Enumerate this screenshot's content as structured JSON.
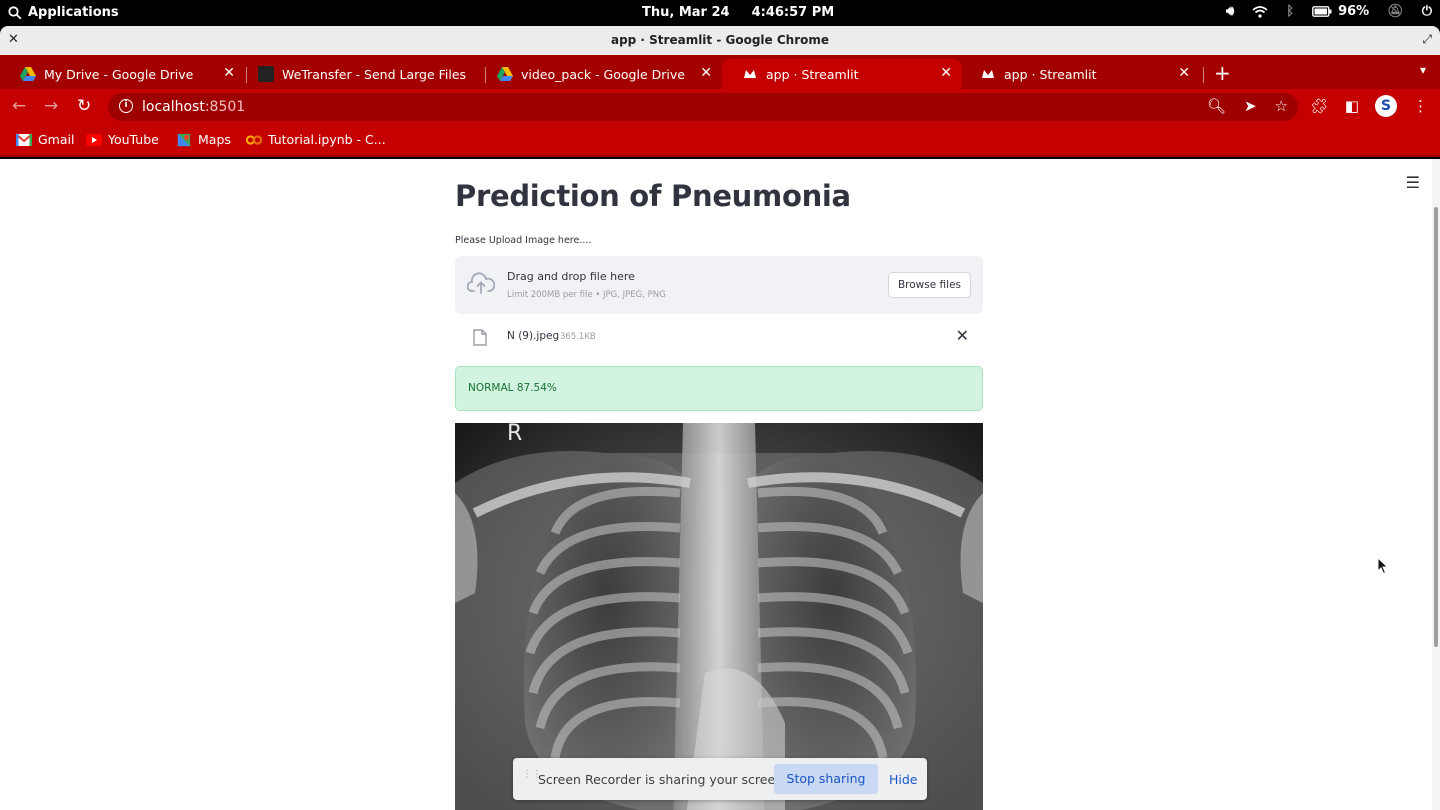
{
  "system": {
    "applications_label": "Applications",
    "date": "Thu, Mar 24",
    "time": "4:46:57 PM",
    "battery": "96%"
  },
  "window": {
    "title": "app · Streamlit - Google Chrome"
  },
  "tabs": [
    {
      "label": "My Drive - Google Drive",
      "icon": "google-drive-icon"
    },
    {
      "label": "WeTransfer - Send Large Files",
      "icon": "wetransfer-icon"
    },
    {
      "label": "video_pack - Google Drive",
      "icon": "google-drive-icon"
    },
    {
      "label": "app · Streamlit",
      "icon": "streamlit-icon",
      "active": true
    },
    {
      "label": "app · Streamlit",
      "icon": "streamlit-icon"
    }
  ],
  "address": {
    "host": "localhost",
    "port": ":8501"
  },
  "bookmarks": [
    {
      "label": "Gmail",
      "icon": "gmail-icon"
    },
    {
      "label": "YouTube",
      "icon": "youtube-icon"
    },
    {
      "label": "Maps",
      "icon": "maps-icon"
    },
    {
      "label": "Tutorial.ipynb - C...",
      "icon": "colab-icon"
    }
  ],
  "app": {
    "title": "Prediction of Pneumonia",
    "upload_label": "Please Upload Image here....",
    "dropzone_title": "Drag and drop file here",
    "dropzone_limit": "Limit 200MB per file • JPG, JPEG, PNG",
    "browse_label": "Browse files",
    "file_name": "N (9).jpeg",
    "file_size": "365.1KB",
    "result": "NORMAL 87.54%",
    "xray_marker": "R",
    "colors": {
      "success_bg": "#d2f3df",
      "success_text": "#177233",
      "text": "#31333f"
    }
  },
  "share_bar": {
    "message": "Screen Recorder is sharing your screen.",
    "stop_label": "Stop sharing",
    "hide_label": "Hide"
  },
  "chrome_colors": {
    "tabstrip": "#a30000",
    "toolbar": "#c40000"
  }
}
